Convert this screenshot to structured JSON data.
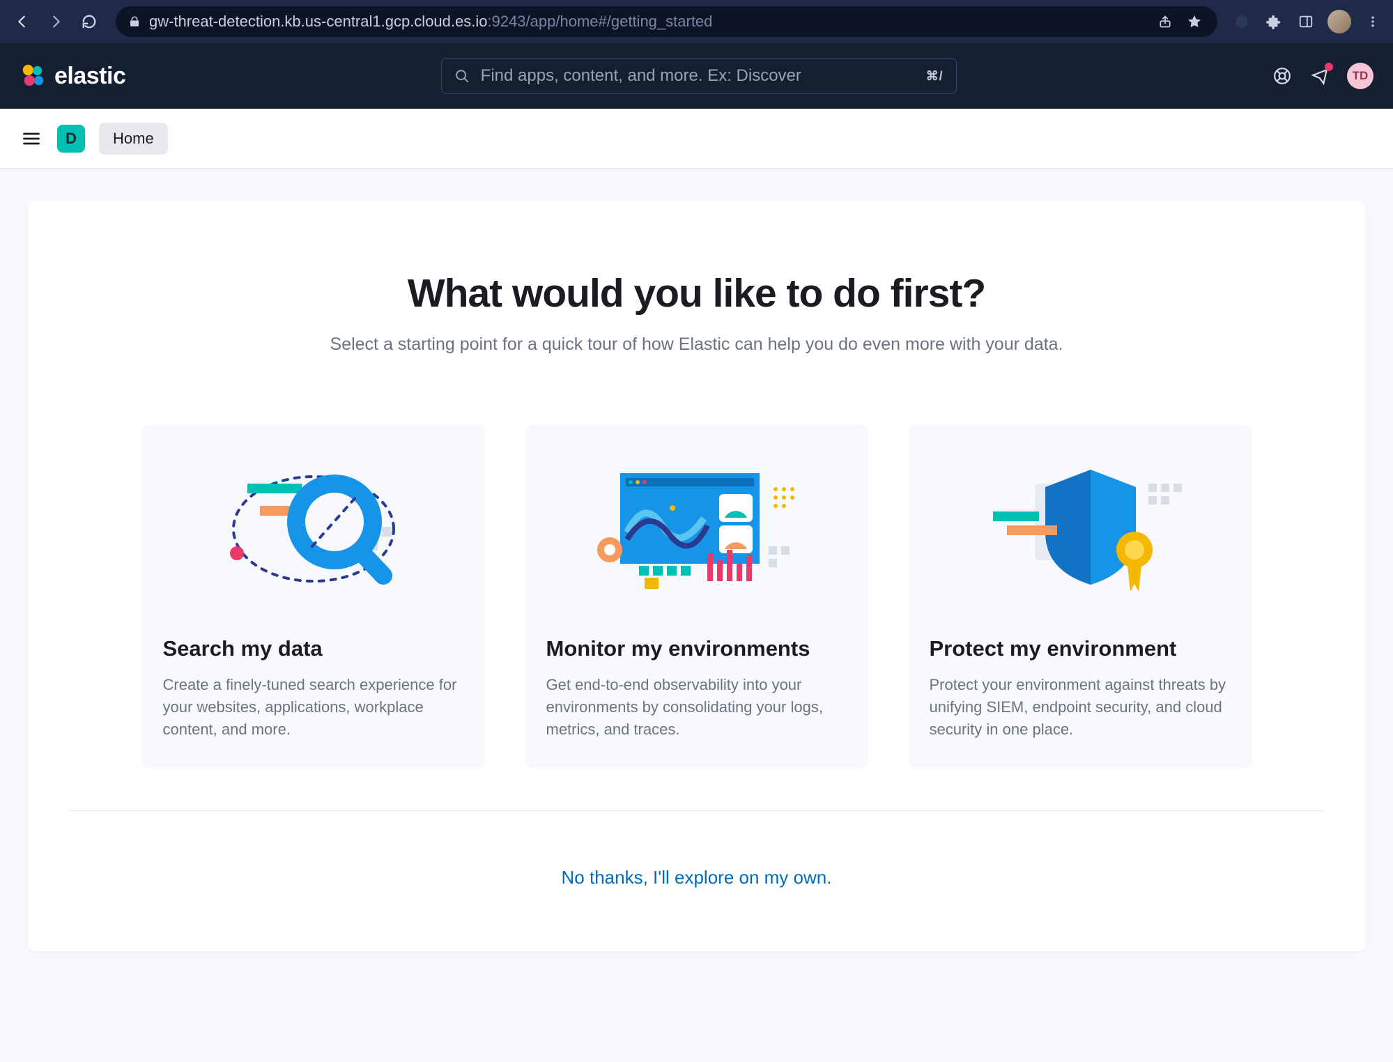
{
  "browser": {
    "url_host": "gw-threat-detection.kb.us-central1.gcp.cloud.es.io",
    "url_port": ":9243",
    "url_path": "/app/home#/getting_started"
  },
  "topbar": {
    "brand": "elastic",
    "search_placeholder": "Find apps, content, and more. Ex: Discover",
    "search_shortcut": "⌘/",
    "avatar_initials": "TD"
  },
  "subheader": {
    "space_letter": "D",
    "crumb": "Home"
  },
  "hero": {
    "title": "What would you like to do first?",
    "subtitle": "Select a starting point for a quick tour of how Elastic can help you do even more with your data."
  },
  "cards": [
    {
      "title": "Search my data",
      "desc": "Create a finely-tuned search experience for your websites, applications, workplace content, and more."
    },
    {
      "title": "Monitor my environments",
      "desc": "Get end-to-end observability into your environments by consolidating your logs, metrics, and traces."
    },
    {
      "title": "Protect my environment",
      "desc": "Protect your environment against threats by unifying SIEM, endpoint security, and cloud security in one place."
    }
  ],
  "skip_link": "No thanks, I'll explore on my own.",
  "colors": {
    "accent_teal": "#00bfb3",
    "accent_blue": "#1694e8",
    "accent_pink": "#e83a6a",
    "accent_orange": "#f79a5e",
    "accent_yellow": "#f5b800",
    "brand_navy": "#141f32"
  }
}
